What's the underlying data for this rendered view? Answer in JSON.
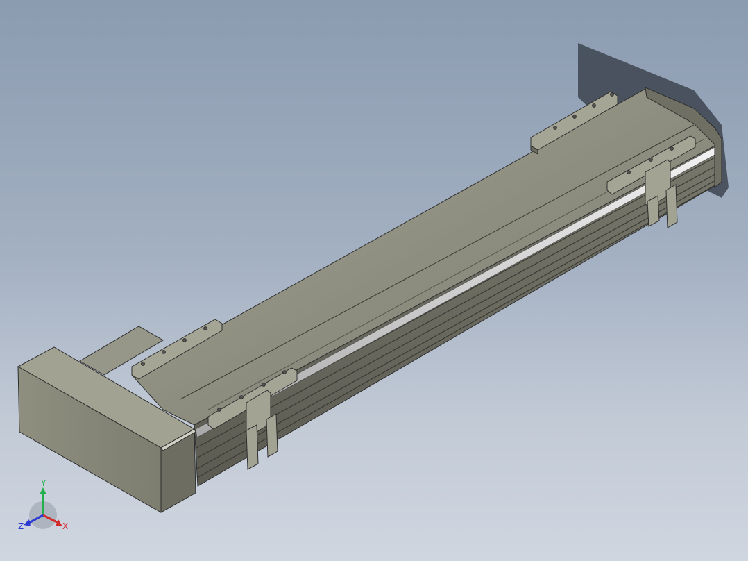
{
  "viewport": {
    "background_top": "#8b9bb0",
    "background_bottom": "#cfd6e0"
  },
  "model": {
    "body_color": "#8a8a7c",
    "top_color": "#9b9b8c",
    "rail_color": "#d8d8d8",
    "edge_color": "#2e2e2e"
  },
  "triad": {
    "x_label": "X",
    "y_label": "Y",
    "z_label": "Z",
    "x_color": "#d22b2b",
    "y_color": "#22b04a",
    "z_color": "#2b3bd2"
  }
}
